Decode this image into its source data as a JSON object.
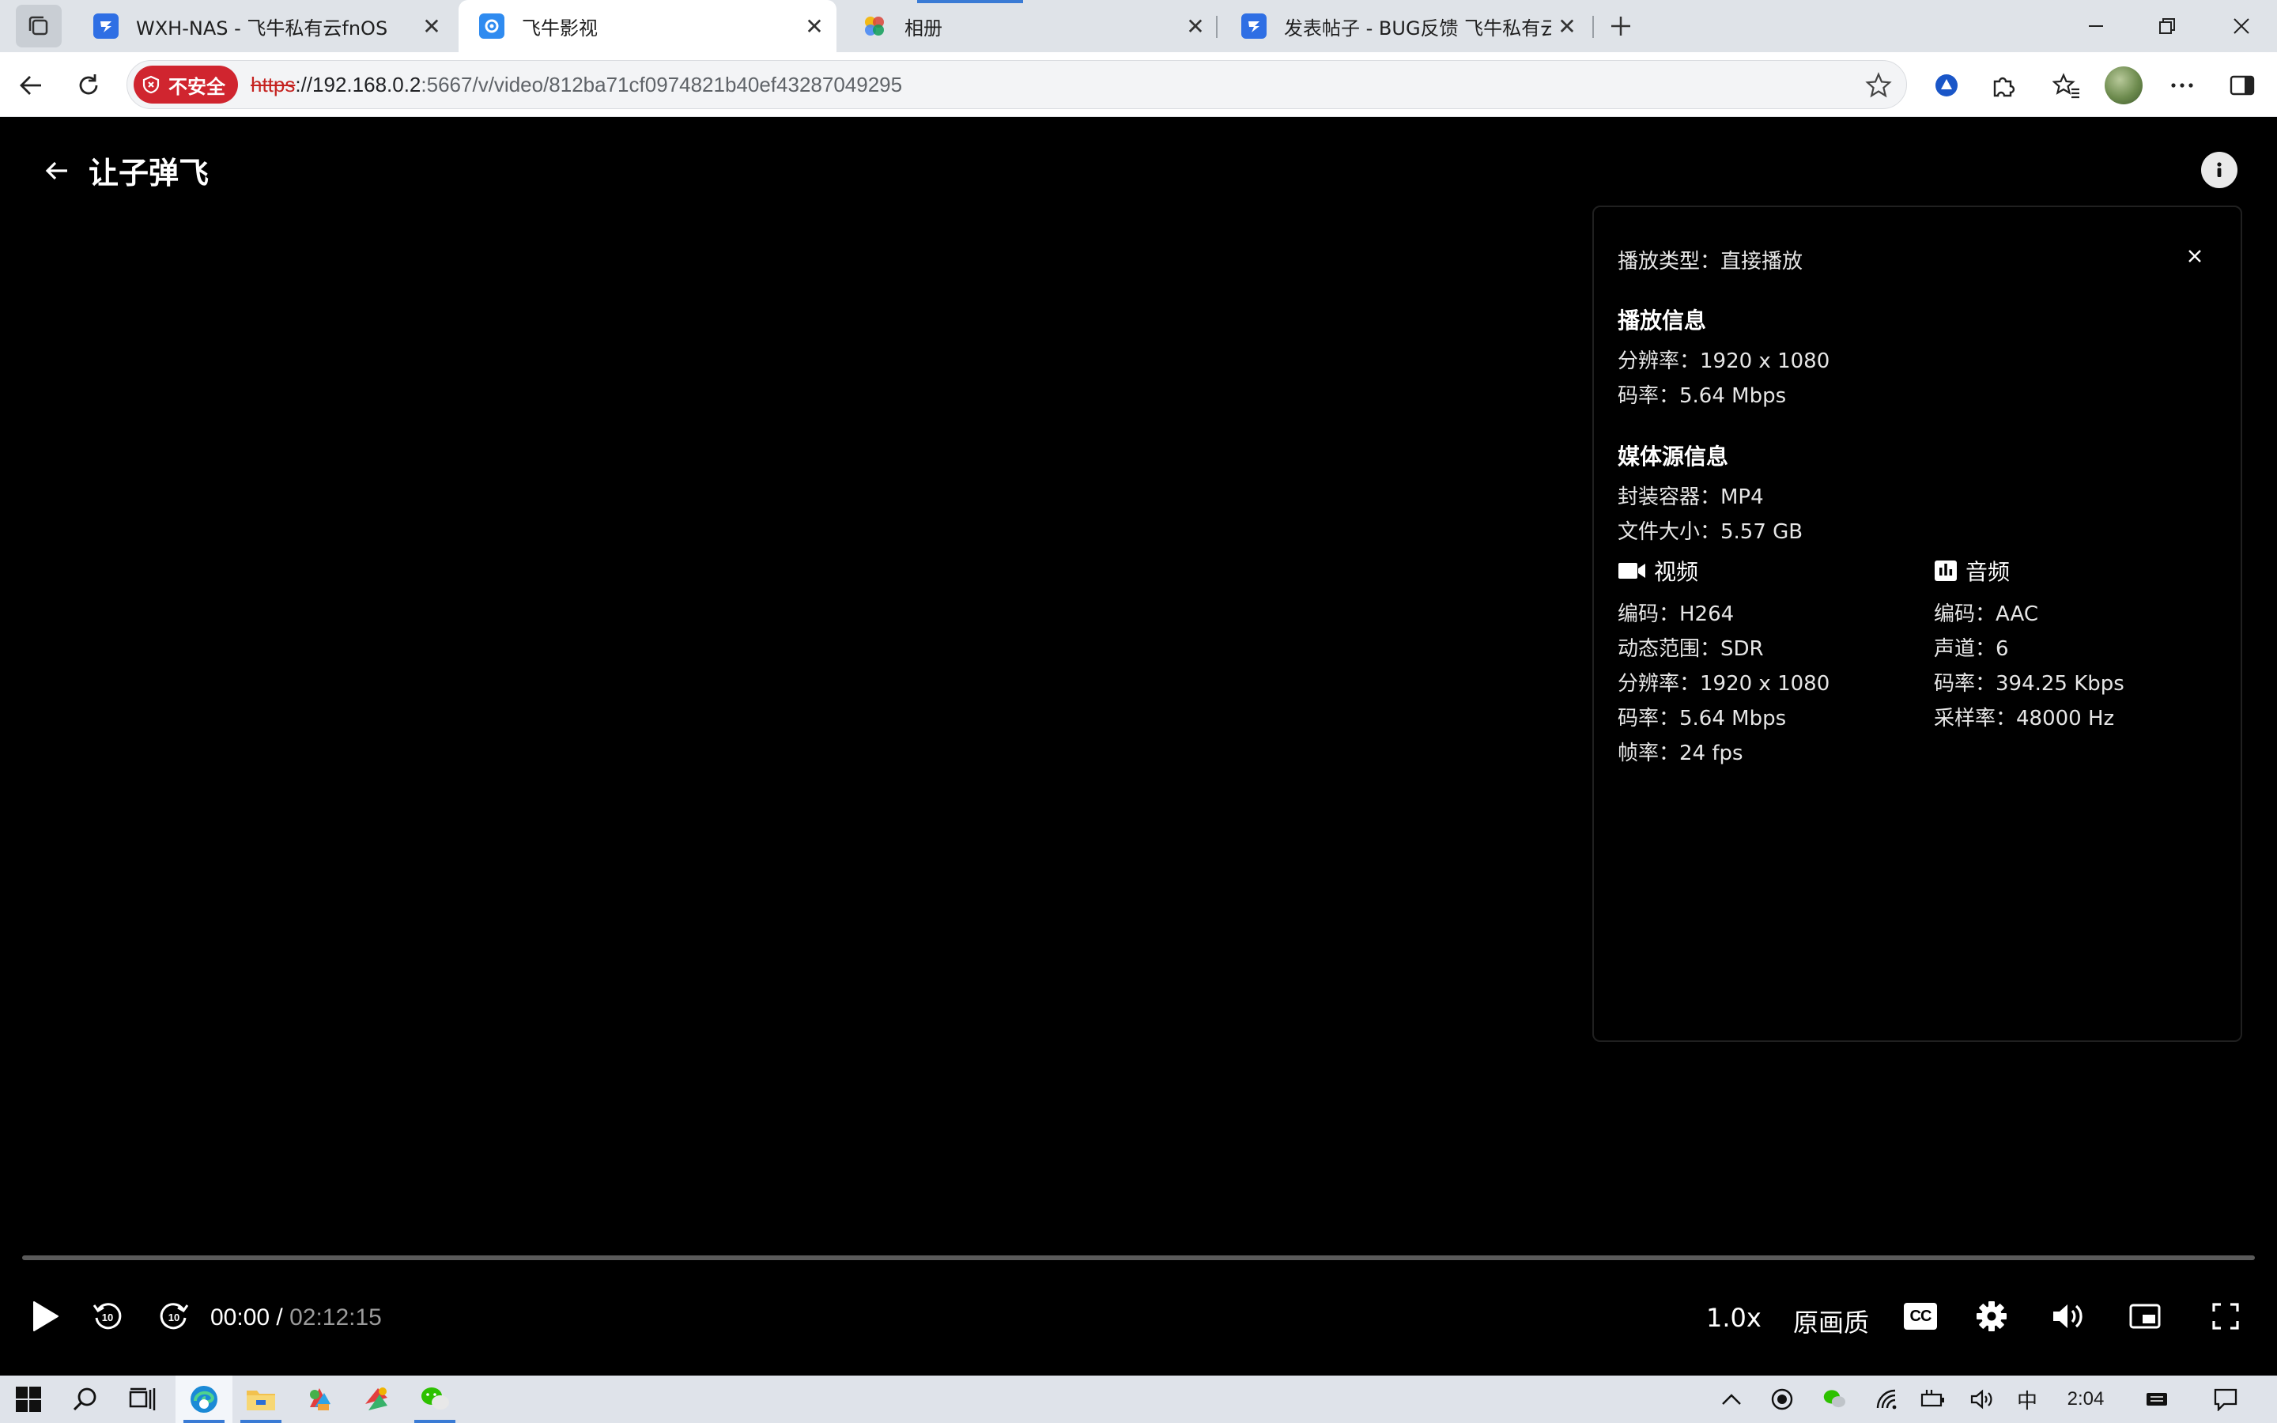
{
  "browser": {
    "tabs": [
      {
        "title": "WXH-NAS - 飞牛私有云fnOS",
        "icon": "fnos-icon",
        "active": false
      },
      {
        "title": "飞牛影视",
        "icon": "fn-video-icon",
        "active": true
      },
      {
        "title": "相册",
        "icon": "photos-icon",
        "active": false
      },
      {
        "title": "发表帖子 - BUG反馈 飞牛私有云论坛",
        "icon": "fnos-icon",
        "active": false
      }
    ],
    "new_tab_label": "+",
    "security_label": "不安全",
    "url_protocol": "https",
    "url_host": "://192.168.0.2",
    "url_rest": ":5667/v/video/812ba71cf0974821b40ef43287049295"
  },
  "player": {
    "title": "让子弹飞",
    "info_panel": {
      "play_type": "播放类型：直接播放",
      "playback_heading": "播放信息",
      "playback_resolution": "分辨率：1920 x 1080",
      "playback_bitrate": "码率：5.64 Mbps",
      "source_heading": "媒体源信息",
      "container": "封装容器：MP4",
      "file_size": "文件大小：5.57 GB",
      "video_heading": "视频",
      "video": {
        "codec": "编码：H264",
        "dynamic_range": "动态范围：SDR",
        "resolution": "分辨率：1920 x 1080",
        "bitrate": "码率：5.64 Mbps",
        "framerate": "帧率：24 fps"
      },
      "audio_heading": "音频",
      "audio": {
        "codec": "编码：AAC",
        "channels": "声道：6",
        "bitrate": "码率：394.25 Kbps",
        "sample_rate": "采样率：48000 Hz"
      }
    },
    "controls": {
      "current_time": "00:00",
      "separator": " / ",
      "total_time": "02:12:15",
      "progress_fraction": 0,
      "speed": "1.0x",
      "quality": "原画质",
      "cc_label": "CC",
      "rewind_seconds": "10",
      "forward_seconds": "10"
    }
  },
  "taskbar": {
    "ime": "中",
    "clock": "2:04"
  },
  "colors": {
    "insecure_red": "#d0252f",
    "accent_blue": "#3a7bd5",
    "fn_blue": "#2f6fe4"
  }
}
